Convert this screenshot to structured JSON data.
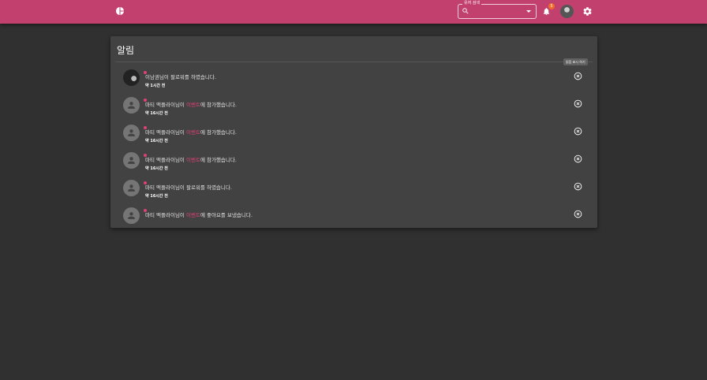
{
  "appbar": {
    "logo_icon": "pie-chart-logo-icon",
    "search": {
      "label": "유저 검색",
      "value": "",
      "placeholder": ""
    },
    "notification_count": "5",
    "accent_color": "#c2406e"
  },
  "panel": {
    "title": "알림",
    "tooltip": "읽음 표시 하기"
  },
  "notifications": [
    {
      "before": "이남권님이 팔로워를 하였습니다.",
      "link": "",
      "after": "",
      "time": "약 1시간 전",
      "avatar": "photo"
    },
    {
      "before": "마티 맥플라이님이 ",
      "link": "이벤트",
      "after": "에 참가했습니다.",
      "time": "약 16시간 전",
      "avatar": "default"
    },
    {
      "before": "마티 맥플라이님이 ",
      "link": "이벤트",
      "after": "에 참가했습니다.",
      "time": "약 16시간 전",
      "avatar": "default"
    },
    {
      "before": "마티 맥플라이님이 ",
      "link": "이벤트",
      "after": "에 참가했습니다.",
      "time": "약 16시간 전",
      "avatar": "default"
    },
    {
      "before": "마티 맥플라이님이 팔로워를 하였습니다.",
      "link": "",
      "after": "",
      "time": "약 16시간 전",
      "avatar": "default"
    },
    {
      "before": "마티 맥플라이님이 ",
      "link": "이벤트",
      "after": "에 좋아요를 보냈습니다.",
      "time": "",
      "avatar": "default"
    }
  ]
}
